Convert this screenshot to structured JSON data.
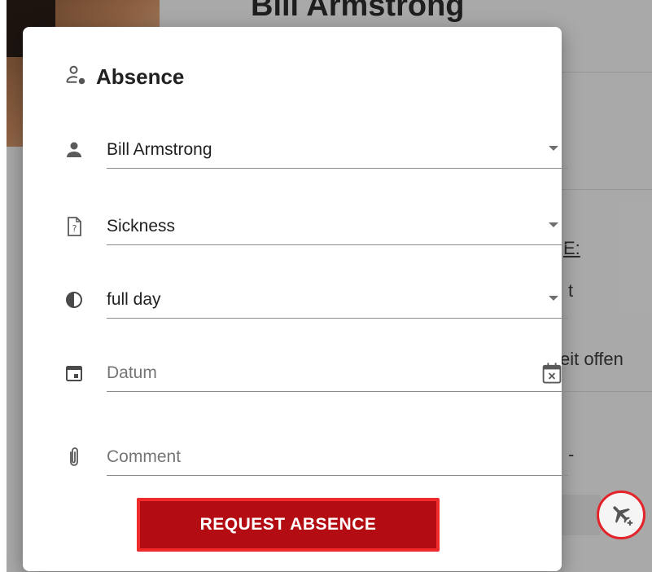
{
  "background": {
    "title": "Bill Armstrong",
    "text_1": "E:",
    "text_2": "t",
    "text_3": "eit offen",
    "text_4": "-"
  },
  "dialog": {
    "title": "Absence",
    "title_icon": "person-status-icon",
    "fields": {
      "person": {
        "icon": "person-icon",
        "value": "Bill Armstrong"
      },
      "type": {
        "icon": "help-document-icon",
        "value": "Sickness"
      },
      "duration": {
        "icon": "half-circle-icon",
        "value": "full day"
      },
      "date": {
        "icon": "calendar-icon",
        "placeholder": "Datum",
        "trailing_icon": "calendar-clear-icon"
      },
      "comment": {
        "icon": "paperclip-icon",
        "placeholder": "Comment"
      }
    },
    "submit_label": "REQUEST ABSENCE"
  },
  "fab": {
    "icon": "airplane-add-icon"
  },
  "colors": {
    "accent": "#b30d13",
    "accent_border": "#ef2b2b",
    "fab_ring": "#e3232a"
  }
}
